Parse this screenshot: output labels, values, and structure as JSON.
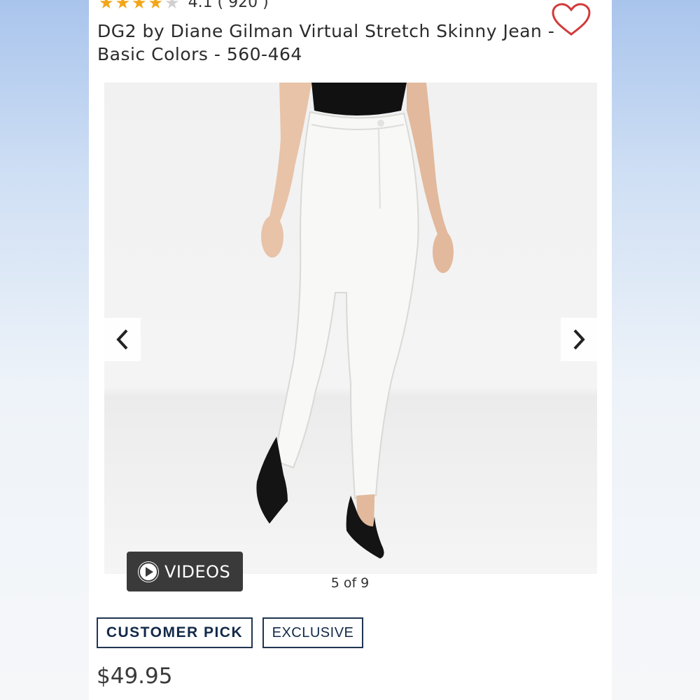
{
  "product": {
    "rating": {
      "score": 4.1,
      "text": "4.1 ( 920 )",
      "stars_filled": 4,
      "stars_total": 5
    },
    "title": "DG2 by Diane Gilman Virtual Stretch Skinny Jean - Basic Colors  - 560-464",
    "price": "$49.95"
  },
  "gallery": {
    "counter": "5 of 9",
    "videos_label": "VIDEOS"
  },
  "badges": {
    "customer_pick": "CUSTOMER PICK",
    "exclusive": "EXCLUSIVE"
  },
  "colors": {
    "star": "#f2a516",
    "heart": "#d23a3a",
    "badge_border": "#1f3552"
  },
  "icons": {
    "favorite": "heart-outline-icon",
    "prev": "chevron-left-icon",
    "next": "chevron-right-icon",
    "play": "play-icon"
  }
}
